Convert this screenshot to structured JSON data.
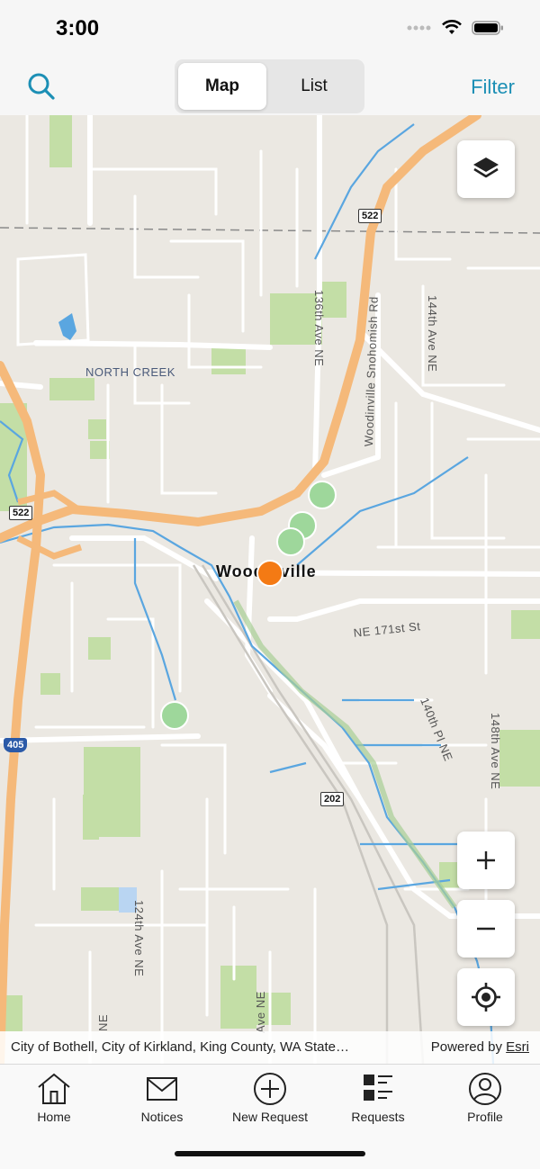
{
  "status": {
    "time": "3:00"
  },
  "nav": {
    "segments": [
      "Map",
      "List"
    ],
    "active_segment": "Map",
    "filter_label": "Filter"
  },
  "map": {
    "labels": {
      "north_creek": "NORTH CREEK",
      "city": "Woodinville",
      "ave_136": "136th Ave NE",
      "woodinville_snohomish": "Woodinville Snohomish Rd",
      "ave_144": "144th Ave NE",
      "st_171": "NE 171st St",
      "pl_140": "140th Pl NE",
      "ave_148": "148th Ave NE",
      "ave_124": "124th Ave NE",
      "ave_bottom": "Ave NE",
      "ne_bottom": "NE"
    },
    "shields": {
      "sr522_top": "522",
      "sr522_left": "522",
      "sr202": "202",
      "i405": "405"
    },
    "colors": {
      "background": "#ebe8e2",
      "highway": "#f5b97a",
      "park": "#c3dea6",
      "water": "#5aa6e0",
      "point_green": "#9ed79b",
      "point_orange": "#f47a14"
    }
  },
  "attribution": {
    "sources": "City of Bothell, City of Kirkland, King County, WA State…",
    "powered_by": "Powered by",
    "esri": "Esri"
  },
  "tabs": [
    {
      "label": "Home",
      "icon": "home-icon"
    },
    {
      "label": "Notices",
      "icon": "envelope-icon"
    },
    {
      "label": "New Request",
      "icon": "plus-circle-icon"
    },
    {
      "label": "Requests",
      "icon": "list-icon"
    },
    {
      "label": "Profile",
      "icon": "profile-icon"
    }
  ]
}
